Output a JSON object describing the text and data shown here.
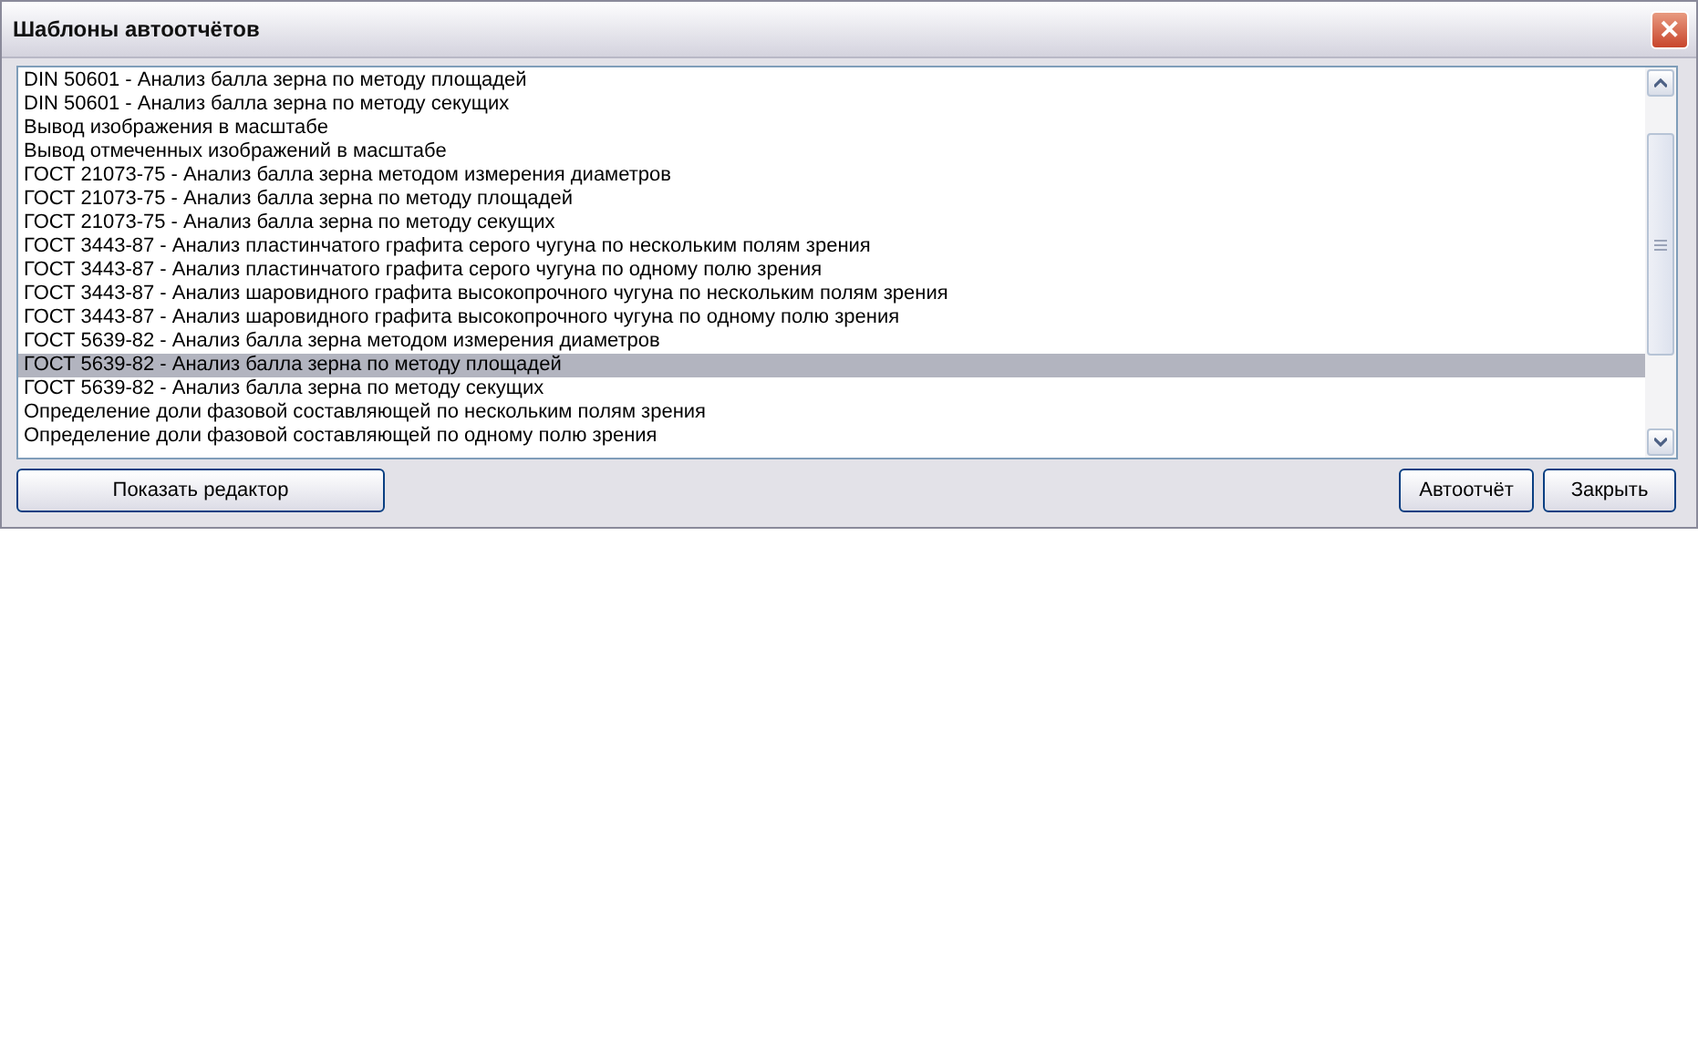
{
  "window": {
    "title": "Шаблоны автоотчётов",
    "close": "✕"
  },
  "list": {
    "items": [
      {
        "label": "DIN 50601 - Анализ балла зерна по методу площадей",
        "selected": false
      },
      {
        "label": "DIN 50601 - Анализ балла зерна по методу секущих",
        "selected": false
      },
      {
        "label": "Вывод изображения в масштабе",
        "selected": false
      },
      {
        "label": "Вывод отмеченных изображений в масштабе",
        "selected": false
      },
      {
        "label": "ГОСТ 21073-75 - Анализ балла зерна методом измерения диаметров",
        "selected": false
      },
      {
        "label": "ГОСТ 21073-75 - Анализ балла зерна по методу площадей",
        "selected": false
      },
      {
        "label": "ГОСТ 21073-75 - Анализ балла зерна по методу секущих",
        "selected": false
      },
      {
        "label": "ГОСТ 3443-87 - Анализ пластинчатого графита серого чугуна по нескольким полям зрения",
        "selected": false
      },
      {
        "label": "ГОСТ 3443-87 - Анализ пластинчатого графита серого чугуна по одному полю зрения",
        "selected": false
      },
      {
        "label": "ГОСТ 3443-87 - Анализ шаровидного графита высокопрочного чугуна по нескольким полям зрения",
        "selected": false
      },
      {
        "label": "ГОСТ 3443-87 - Анализ шаровидного графита высокопрочного чугуна по одному полю зрения",
        "selected": false
      },
      {
        "label": "ГОСТ 5639-82 - Анализ балла зерна методом измерения диаметров",
        "selected": false
      },
      {
        "label": "ГОСТ 5639-82 - Анализ балла зерна по методу площадей",
        "selected": true
      },
      {
        "label": "ГОСТ 5639-82 - Анализ балла зерна по методу секущих",
        "selected": false
      },
      {
        "label": "Определение доли фазовой составляющей по нескольким полям зрения",
        "selected": false
      },
      {
        "label": "Определение доли фазовой составляющей по одному полю зрения",
        "selected": false
      }
    ]
  },
  "buttons": {
    "left": [
      "Показать редактор"
    ],
    "right": [
      "Автоотчёт",
      "Закрыть"
    ]
  }
}
